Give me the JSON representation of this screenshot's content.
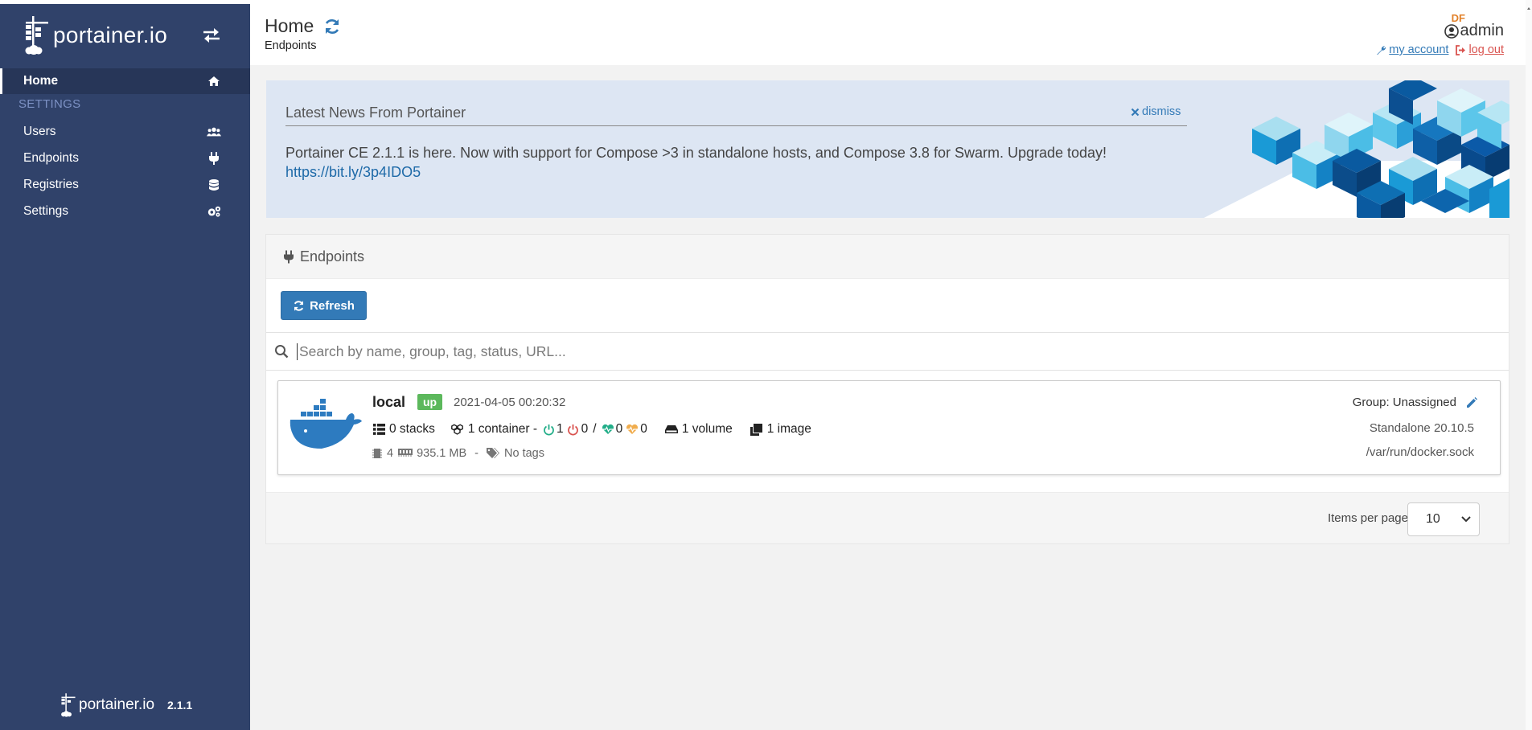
{
  "sidebar": {
    "brand": "portainer.io",
    "items": [
      {
        "label": "Home",
        "icon": "home-icon"
      },
      {
        "label": "Users",
        "icon": "users-icon"
      },
      {
        "label": "Endpoints",
        "icon": "plug-icon"
      },
      {
        "label": "Registries",
        "icon": "database-icon"
      },
      {
        "label": "Settings",
        "icon": "cogs-icon"
      }
    ],
    "section": "SETTINGS",
    "footer_brand": "portainer.io",
    "version": "2.1.1"
  },
  "header": {
    "title": "Home",
    "breadcrumb": "Endpoints",
    "user_initials": "DF",
    "username": "admin",
    "my_account": "my account",
    "log_out": "log out"
  },
  "news": {
    "title": "Latest News From Portainer",
    "dismiss": "dismiss",
    "text": "Portainer CE 2.1.1 is here. Now with support for Compose >3 in standalone hosts, and Compose 3.8 for Swarm. Upgrade today!",
    "link": "https://bit.ly/3p4IDO5"
  },
  "endpoints": {
    "title": "Endpoints",
    "refresh": "Refresh",
    "search_placeholder": "Search by name, group, tag, status, URL...",
    "items": [
      {
        "name": "local",
        "status": "up",
        "date": "2021-04-05 00:20:32",
        "stacks": "0 stacks",
        "containers": "1 container -",
        "running": "1",
        "stopped": "0",
        "separator": "/",
        "healthy": "0",
        "unhealthy": "0",
        "volumes": "1 volume",
        "images": "1 image",
        "cpu": "4",
        "memory": "935.1 MB",
        "dash": "-",
        "tags": "No tags",
        "group": "Group: Unassigned",
        "engine": "Standalone 20.10.5",
        "url": "/var/run/docker.sock"
      }
    ],
    "items_per_page_label": "Items per page",
    "items_per_page": "10"
  },
  "colors": {
    "sidebar": "#30426a",
    "primary": "#337ab7",
    "success": "#5cb85c",
    "danger": "#d9534f",
    "news_bg": "#dde6f3"
  }
}
